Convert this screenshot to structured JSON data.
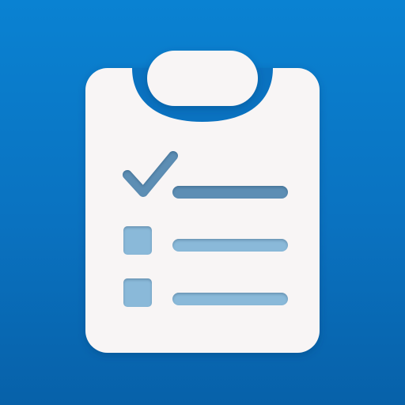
{
  "icon": {
    "name": "checklist-clipboard-icon",
    "items": [
      {
        "state": "checked",
        "marker_icon": "checkmark-icon"
      },
      {
        "state": "unchecked",
        "marker_icon": "checkbox-icon"
      },
      {
        "state": "unchecked",
        "marker_icon": "checkbox-icon"
      }
    ]
  },
  "colors": {
    "background_top": "#0a82d2",
    "background_bottom": "#0761a9",
    "clipboard": "#f8f5f5",
    "clip_ring": "#0a72c0",
    "checked_ink": "#5d8eb4",
    "unchecked_ink": "#8ab9d9"
  }
}
